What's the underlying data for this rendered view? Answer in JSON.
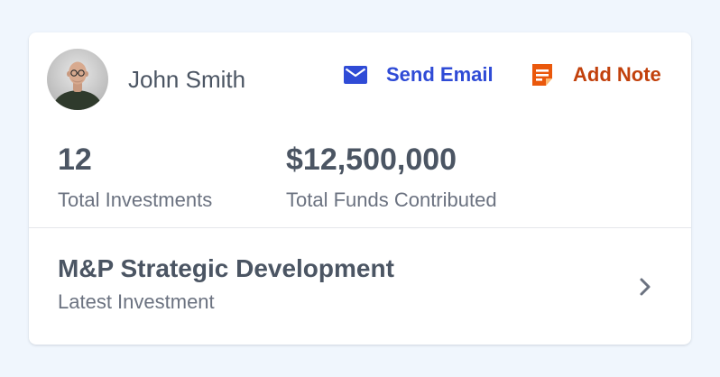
{
  "profile": {
    "name": "John Smith",
    "avatar_alt": "John Smith"
  },
  "actions": {
    "send_email": {
      "label": "Send Email",
      "icon": "mail-icon",
      "color": "#2f4bd6"
    },
    "add_note": {
      "label": "Add Note",
      "icon": "note-icon",
      "color": "#c2410c"
    }
  },
  "stats": [
    {
      "value": "12",
      "label": "Total Investments"
    },
    {
      "value": "$12,500,000",
      "label": "Total Funds Contributed"
    }
  ],
  "latest_investment": {
    "title": "M&P Strategic Development",
    "subtitle": "Latest Investment",
    "icon": "chevron-right-icon"
  },
  "colors": {
    "background": "#f0f6fd",
    "card": "#ffffff",
    "text_primary": "#4b5563",
    "text_secondary": "#6b7280"
  }
}
